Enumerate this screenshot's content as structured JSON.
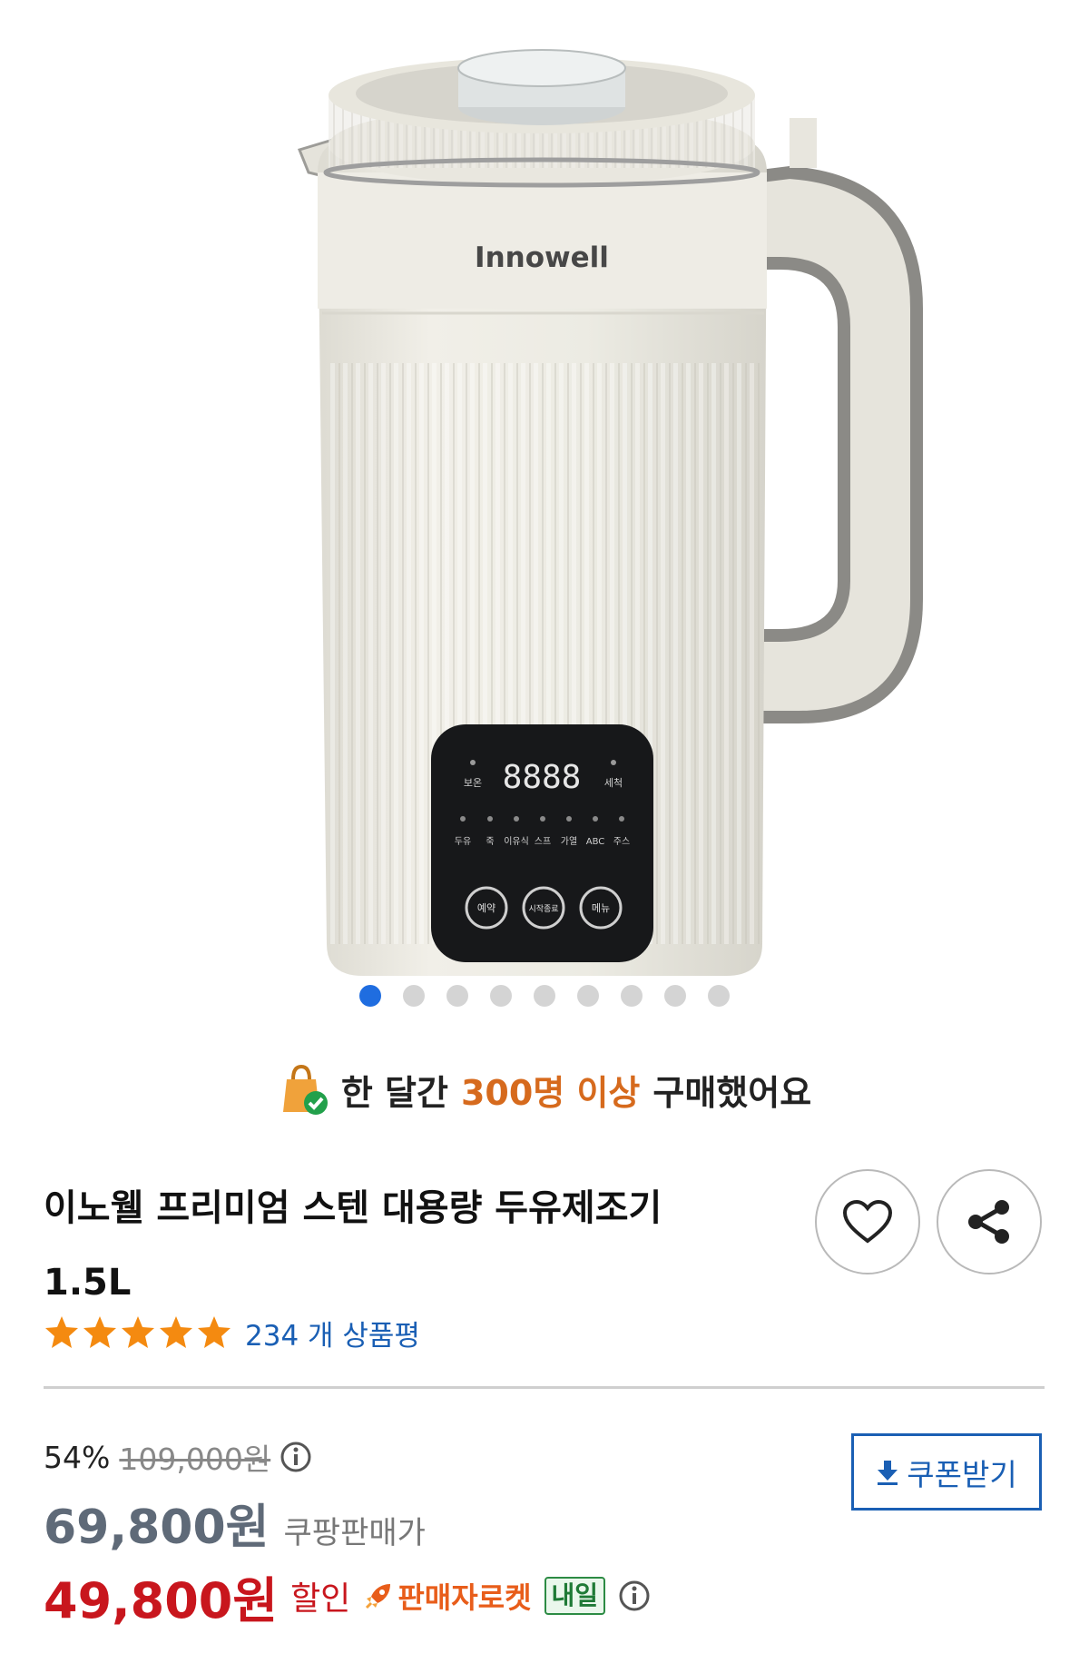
{
  "product_image": {
    "brand_text": "Innowell",
    "display_digits": "8888",
    "panel_top_labels": [
      "보온",
      "세척"
    ],
    "panel_menu_labels": [
      "두유",
      "죽",
      "이유식",
      "스프",
      "가열",
      "ABC",
      "주스"
    ],
    "panel_buttons": [
      "예약",
      "시작종료",
      "메뉴"
    ]
  },
  "gallery": {
    "total_slides": 9,
    "active_index": 0
  },
  "social_proof": {
    "prefix": "한 달간",
    "highlight": "300명 이상",
    "suffix": "구매했어요"
  },
  "product": {
    "title_line1": "이노웰 프리미엄 스텐 대용량 두유제조기",
    "title_line2": "1.5L"
  },
  "rating": {
    "stars": 5,
    "review_text": "234 개 상품평"
  },
  "pricing": {
    "discount_rate": "54%",
    "original_price": "109,000원",
    "coupang_price": "69,800원",
    "coupang_price_label": "쿠팡판매가",
    "sale_price": "49,800원",
    "sale_label": "할인",
    "rocket_badge": "판매자로켓",
    "delivery_badge": "내일"
  },
  "coupon": {
    "label": "쿠폰받기"
  },
  "colors": {
    "accent_blue": "#1a5fb4",
    "sale_red": "#c8161d",
    "highlight_orange": "#d66a1d",
    "star": "#f48a10"
  }
}
